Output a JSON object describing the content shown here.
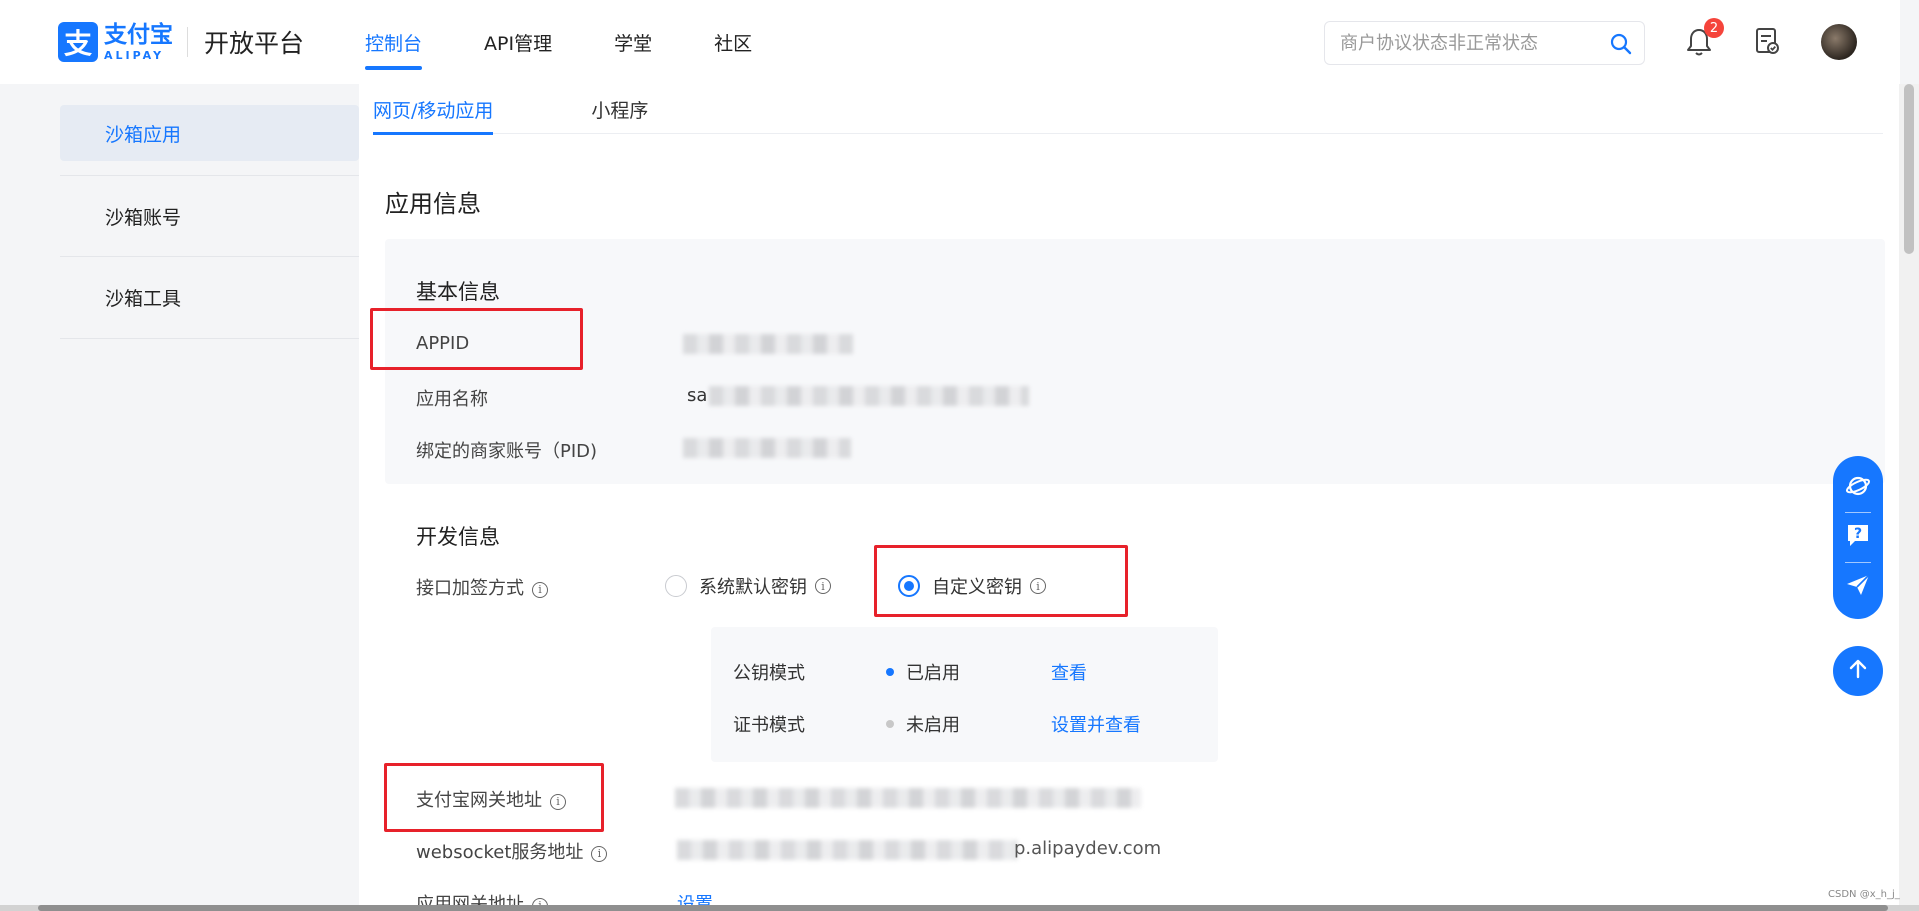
{
  "brand": {
    "logo_glyph": "支",
    "logo_cn": "支付宝",
    "logo_en": "ALIPAY",
    "platform": "开放平台",
    "accent": "#1677ff"
  },
  "nav": {
    "items": [
      {
        "label": "控制台",
        "active": true
      },
      {
        "label": "API管理"
      },
      {
        "label": "学堂"
      },
      {
        "label": "社区"
      }
    ]
  },
  "search": {
    "placeholder": "商户协议状态非正常状态",
    "icon": "search-icon"
  },
  "notifications": {
    "icon": "bell-icon",
    "count": "2"
  },
  "sidebar": {
    "items": [
      {
        "label": "沙箱应用",
        "active": true
      },
      {
        "label": "沙箱账号"
      },
      {
        "label": "沙箱工具"
      }
    ]
  },
  "tabs": [
    {
      "label": "网页/移动应用",
      "active": true
    },
    {
      "label": "小程序"
    }
  ],
  "page_title": "应用信息",
  "basic_info": {
    "heading": "基本信息",
    "rows": [
      {
        "label": "APPID",
        "value": ""
      },
      {
        "label": "应用名称",
        "value": "sa"
      },
      {
        "label": "绑定的商家账号（PID)",
        "value": ""
      }
    ]
  },
  "dev_info": {
    "heading": "开发信息",
    "sign_method": {
      "label": "接口加签方式",
      "options": [
        {
          "label": "系统默认密钥",
          "selected": false
        },
        {
          "label": "自定义密钥",
          "selected": true
        }
      ]
    },
    "modes": [
      {
        "name": "公钥模式",
        "status": "已启用",
        "status_color": "#1677ff",
        "action": "查看"
      },
      {
        "name": "证书模式",
        "status": "未启用",
        "status_color": "#c8c8c8",
        "action": "设置并查看"
      }
    ],
    "gateway_label": "支付宝网关地址",
    "websocket_label": "websocket服务地址",
    "websocket_value_tail": "p.alipaydev.com",
    "app_gateway_label": "应用网关地址",
    "app_gateway_action": "设置"
  },
  "watermark": "CSDN @x_h_j_"
}
